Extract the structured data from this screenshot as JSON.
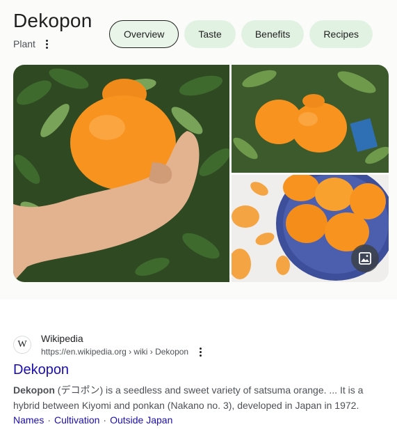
{
  "header": {
    "title": "Dekopon",
    "subtitle": "Plant"
  },
  "chips": [
    {
      "label": "Overview",
      "active": true
    },
    {
      "label": "Taste",
      "active": false
    },
    {
      "label": "Benefits",
      "active": false
    },
    {
      "label": "Recipes",
      "active": false
    }
  ],
  "images": {
    "main": "hand-holding-dekopon-photo",
    "top_right": "dekopon-on-tree-photo",
    "bottom_right": "dekopon-bowl-photo",
    "more_images_icon": "image-icon"
  },
  "result": {
    "favicon": "W",
    "site_name": "Wikipedia",
    "url": "https://en.wikipedia.org › wiki › Dekopon",
    "title": "Dekopon",
    "snippet_bold": "Dekopon",
    "snippet_rest": " (デコポン) is a seedless and sweet variety of satsuma orange. ... It is a hybrid between Kiyomi and ponkan (Nakano no. 3), developed in Japan in 1972.",
    "sitelinks": [
      "Names",
      "Cultivation",
      "Outside Japan"
    ],
    "sitelink_separator": "·"
  },
  "colors": {
    "chip_bg": "#e2f2e2",
    "link": "#1a0dab",
    "fruit": "#f7931e"
  }
}
